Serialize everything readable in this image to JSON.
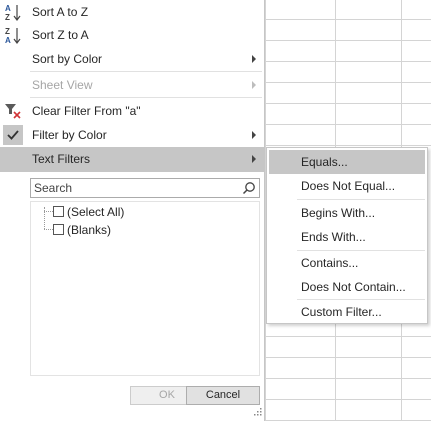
{
  "menu": {
    "sort_az": "Sort A to Z",
    "sort_za": "Sort Z to A",
    "sort_by_color": "Sort by Color",
    "sheet_view": "Sheet View",
    "clear_filter": "Clear Filter From \"a\"",
    "filter_by_color": "Filter by Color",
    "text_filters": "Text Filters"
  },
  "search": {
    "placeholder": "Search",
    "value": ""
  },
  "tree": {
    "items": [
      {
        "label": "(Select All)",
        "checked": false
      },
      {
        "label": "(Blanks)",
        "checked": false
      }
    ]
  },
  "buttons": {
    "ok": "OK",
    "cancel": "Cancel"
  },
  "submenu": {
    "items": [
      "Equals...",
      "Does Not Equal...",
      "Begins With...",
      "Ends With...",
      "Contains...",
      "Does Not Contain...",
      "Custom Filter..."
    ]
  },
  "icon_names": [
    "sort-ascending-icon",
    "sort-descending-icon",
    "clear-filter-icon",
    "check-icon",
    "search-icon",
    "resize-grip-icon"
  ]
}
